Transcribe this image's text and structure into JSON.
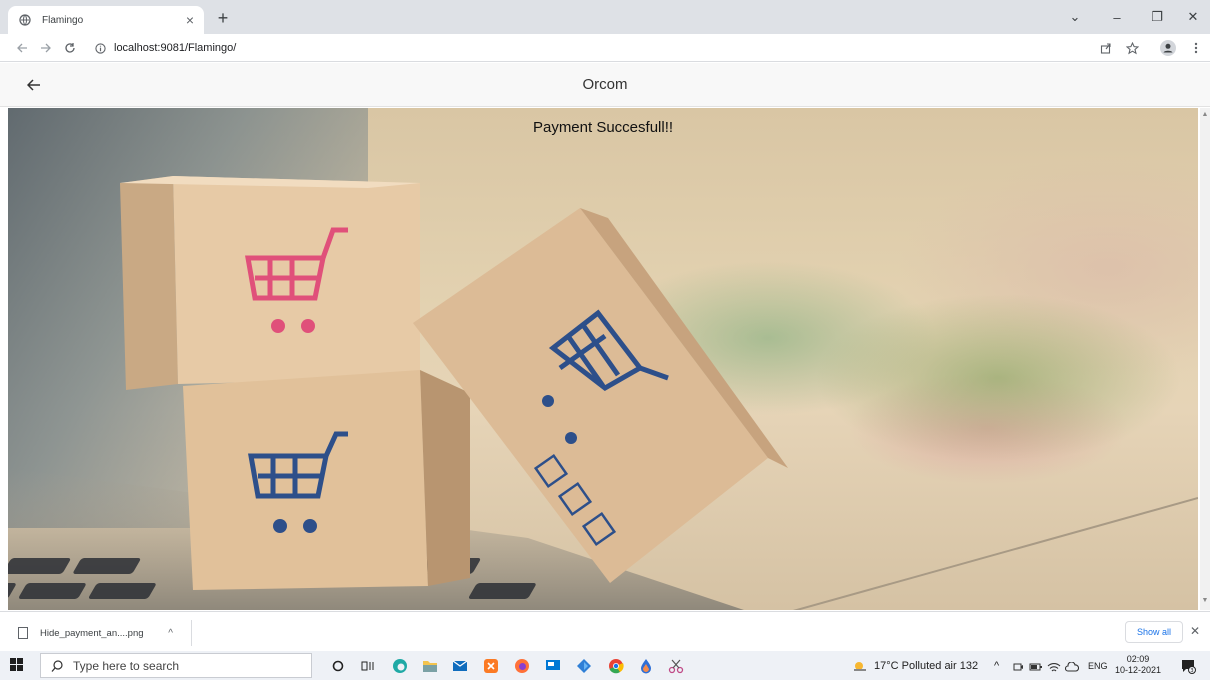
{
  "browser": {
    "tab_title": "Flamingo",
    "tab_close": "×",
    "new_tab": "+",
    "window_controls": {
      "dropdown": "⌄",
      "minimize": "–",
      "restore": "❐",
      "close": "✕"
    },
    "url": "localhost:9081/Flamingo/",
    "icons": [
      "back-icon",
      "forward-icon",
      "reload-icon",
      "info-icon",
      "share-icon",
      "star-icon",
      "profile-icon",
      "menu-icon"
    ]
  },
  "app": {
    "title": "Orcom",
    "back_icon": "arrow-left-icon"
  },
  "main": {
    "message": "Payment Succesfull!!"
  },
  "downloads": {
    "file_name": "Hide_payment_an....png",
    "caret": "^",
    "show_all": "Show all",
    "close": "✕"
  },
  "taskbar": {
    "search_placeholder": "Type here to search",
    "weather": "17°C  Polluted air 132",
    "tray_arrow": "^",
    "language": "ENG",
    "time": "02:09",
    "date": "10-12-2021"
  },
  "colors": {
    "chrome_tabstrip": "#dee1e6",
    "appbar": "#f8f8f8",
    "accent": "#1a73e8"
  }
}
